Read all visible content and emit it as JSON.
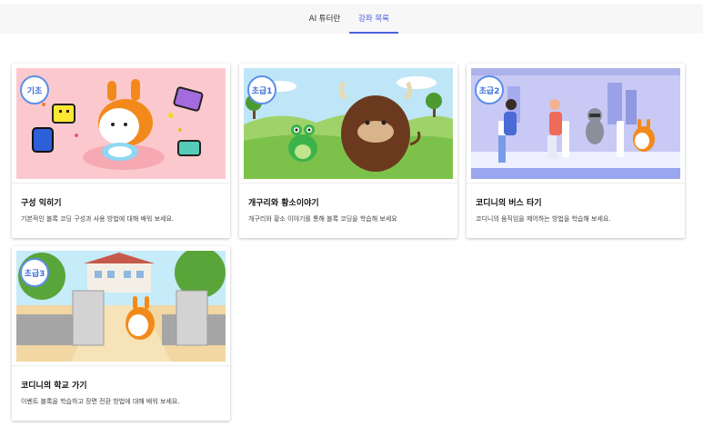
{
  "nav": {
    "tabs": [
      {
        "label": "AI 튜터란"
      },
      {
        "label": "강좌 목록"
      }
    ]
  },
  "courses": [
    {
      "badge": "기초",
      "title": "구성 익히기",
      "description": "기본적인 블록 코딩 구성과 사용 방법에 대해 배워 보세요."
    },
    {
      "badge": "초급1",
      "title": "개구리와 황소이야기",
      "description": "개구리와 황소 이야기를 통해 블록 코딩을 학습해 보세요"
    },
    {
      "badge": "초급2",
      "title": "코디니의 버스 타기",
      "description": "코디니의 움직임을 제어하는 방법을 학습해 보세요."
    },
    {
      "badge": "초급3",
      "title": "코디니의 학교 가기",
      "description": "이벤트 블록을 학습하고 장면 전환 방법에 대해 배워 보세요."
    }
  ],
  "colors": {
    "accent": "#4a63d8",
    "badge_border": "#5b8fe8"
  }
}
